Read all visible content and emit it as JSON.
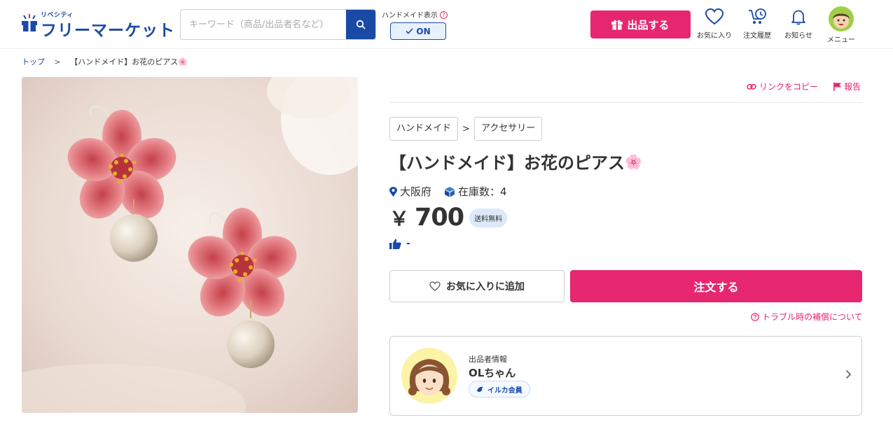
{
  "header": {
    "logo_small": "リベシティ",
    "logo_main": "フリーマーケット",
    "search_placeholder": "キーワード（商品/出品者名など）",
    "handmade_label": "ハンドメイド表示",
    "handmade_toggle": "ON",
    "sell_button": "出品する",
    "nav": [
      {
        "label": "お気に入り",
        "icon": "heart-icon"
      },
      {
        "label": "注文履歴",
        "icon": "order-history-icon"
      },
      {
        "label": "お知らせ",
        "icon": "bell-icon"
      },
      {
        "label": "メニュー",
        "icon": "avatar"
      }
    ]
  },
  "breadcrumb": {
    "home": "トップ",
    "separator": ">",
    "current": "【ハンドメイド】お花のピアス🌸"
  },
  "actions": {
    "copy_link": "リンクをコピー",
    "report": "報告"
  },
  "product": {
    "categories": [
      "ハンドメイド",
      "アクセサリー"
    ],
    "category_separator": ">",
    "title": "【ハンドメイド】お花のピアス",
    "title_emoji": "🌸",
    "location": "大阪府",
    "stock_label": "在庫数：4",
    "currency": "￥",
    "price": "700",
    "shipping_badge": "送料無料",
    "likes": "-",
    "favorite_button": "お気に入りに追加",
    "order_button": "注文する",
    "trouble_link": "トラブル時の補償について"
  },
  "seller": {
    "heading": "出品者情報",
    "name": "OLちゃん",
    "badge": "イルカ会員"
  },
  "colors": {
    "brand_blue": "#1a4aa6",
    "accent_pink": "#e6276f"
  }
}
